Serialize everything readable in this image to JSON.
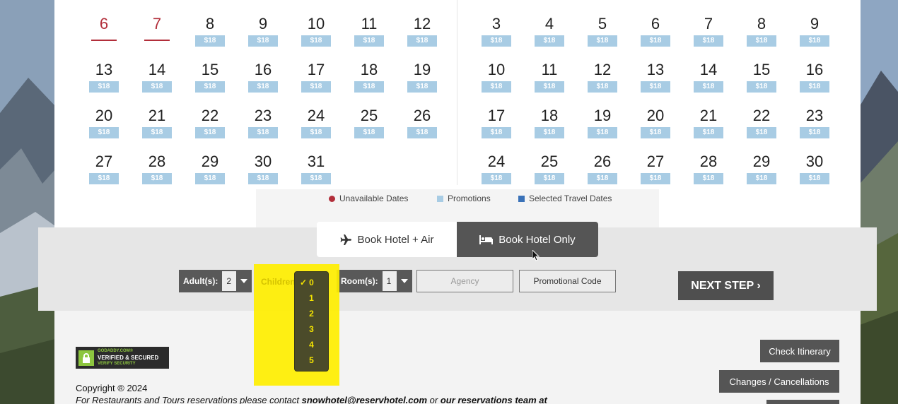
{
  "calendar": {
    "left_month": [
      {
        "day": "6",
        "unavailable": true
      },
      {
        "day": "7",
        "unavailable": true
      },
      {
        "day": "8",
        "price": "$18"
      },
      {
        "day": "9",
        "price": "$18"
      },
      {
        "day": "10",
        "price": "$18"
      },
      {
        "day": "11",
        "price": "$18"
      },
      {
        "day": "12",
        "price": "$18"
      },
      {
        "day": "13",
        "price": "$18"
      },
      {
        "day": "14",
        "price": "$18"
      },
      {
        "day": "15",
        "price": "$18"
      },
      {
        "day": "16",
        "price": "$18"
      },
      {
        "day": "17",
        "price": "$18"
      },
      {
        "day": "18",
        "price": "$18"
      },
      {
        "day": "19",
        "price": "$18"
      },
      {
        "day": "20",
        "price": "$18"
      },
      {
        "day": "21",
        "price": "$18"
      },
      {
        "day": "22",
        "price": "$18"
      },
      {
        "day": "23",
        "price": "$18"
      },
      {
        "day": "24",
        "price": "$18"
      },
      {
        "day": "25",
        "price": "$18"
      },
      {
        "day": "26",
        "price": "$18"
      },
      {
        "day": "27",
        "price": "$18"
      },
      {
        "day": "28",
        "price": "$18"
      },
      {
        "day": "29",
        "price": "$18"
      },
      {
        "day": "30",
        "price": "$18"
      },
      {
        "day": "31",
        "price": "$18"
      }
    ],
    "right_month": [
      {
        "day": "3",
        "price": "$18"
      },
      {
        "day": "4",
        "price": "$18"
      },
      {
        "day": "5",
        "price": "$18"
      },
      {
        "day": "6",
        "price": "$18"
      },
      {
        "day": "7",
        "price": "$18"
      },
      {
        "day": "8",
        "price": "$18"
      },
      {
        "day": "9",
        "price": "$18"
      },
      {
        "day": "10",
        "price": "$18"
      },
      {
        "day": "11",
        "price": "$18"
      },
      {
        "day": "12",
        "price": "$18"
      },
      {
        "day": "13",
        "price": "$18"
      },
      {
        "day": "14",
        "price": "$18"
      },
      {
        "day": "15",
        "price": "$18"
      },
      {
        "day": "16",
        "price": "$18"
      },
      {
        "day": "17",
        "price": "$18"
      },
      {
        "day": "18",
        "price": "$18"
      },
      {
        "day": "19",
        "price": "$18"
      },
      {
        "day": "20",
        "price": "$18"
      },
      {
        "day": "21",
        "price": "$18"
      },
      {
        "day": "22",
        "price": "$18"
      },
      {
        "day": "23",
        "price": "$18"
      },
      {
        "day": "24",
        "price": "$18"
      },
      {
        "day": "25",
        "price": "$18"
      },
      {
        "day": "26",
        "price": "$18"
      },
      {
        "day": "27",
        "price": "$18"
      },
      {
        "day": "28",
        "price": "$18"
      },
      {
        "day": "29",
        "price": "$18"
      },
      {
        "day": "30",
        "price": "$18"
      }
    ]
  },
  "legend": {
    "unavailable": "Unavailable Dates",
    "promotions": "Promotions",
    "selected": "Selected Travel Dates",
    "colors": {
      "unavailable": "#b22e3a",
      "promotions": "#a8cce4",
      "selected": "#3a72b8"
    }
  },
  "tabs": {
    "hotel_air": "Book Hotel + Air",
    "hotel_only": "Book Hotel Only",
    "hotel_air_icon": "plane-icon",
    "hotel_only_icon": "bed-icon"
  },
  "form": {
    "adults_label": "Adult(s):",
    "adults_value": "2",
    "children_label": "Children",
    "children_options": [
      "0",
      "1",
      "2",
      "3",
      "4",
      "5"
    ],
    "children_selected": "0",
    "rooms_label": "Room(s):",
    "rooms_value": "1",
    "agency_placeholder": "Agency",
    "promo_label": "Promotional Code",
    "next_step": "NEXT STEP ›"
  },
  "footer": {
    "badge_top": "GODADDY.COM®",
    "badge_main": "VERIFIED & SECURED",
    "badge_sub": "VERIFY SECURITY",
    "copyright": "Copyright ® 2024",
    "contact_prefix": "For Restaurants and Tours reservations please contact ",
    "contact_email": "snowhotel@reservhotel.com",
    "contact_mid": " or ",
    "contact_team": "our reservations team at",
    "check_itinerary": "Check Itinerary",
    "changes": "Changes / Cancellations"
  }
}
